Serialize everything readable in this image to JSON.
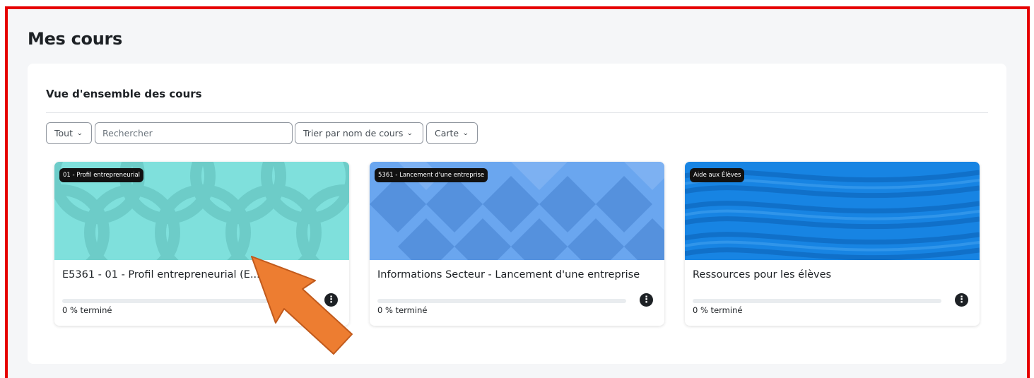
{
  "page": {
    "title": "Mes cours"
  },
  "block": {
    "title": "Vue d'ensemble des cours"
  },
  "controls": {
    "filter": {
      "label": "Tout"
    },
    "search": {
      "placeholder": "Rechercher"
    },
    "sort": {
      "label": "Trier par nom de cours"
    },
    "view": {
      "label": "Carte"
    }
  },
  "courses": [
    {
      "category": "01 - Profil entrepreneurial",
      "name": "E5361 - 01 - Profil entrepreneurial (E...",
      "progress": 0,
      "progress_text": "0 % terminé",
      "pattern": "circles",
      "color": "#7fe0dc"
    },
    {
      "category": "5361 - Lancement d'une entreprise",
      "name": "Informations Secteur - Lancement d'une entreprise",
      "progress": 0,
      "progress_text": "0 % terminé",
      "pattern": "diamonds",
      "color": "#6aa6ef"
    },
    {
      "category": "Aide aux Élèves",
      "name": "Ressources pour les élèves",
      "progress": 0,
      "progress_text": "0 % terminé",
      "pattern": "waves",
      "color": "#1784e3"
    }
  ],
  "icons": {
    "card_menu": "ellipsis-vertical-icon",
    "dropdown": "chevron-down-icon"
  },
  "colors": {
    "frame": "#e60000",
    "arrow": "#ed7d31",
    "progress": "#0f6cbf"
  }
}
